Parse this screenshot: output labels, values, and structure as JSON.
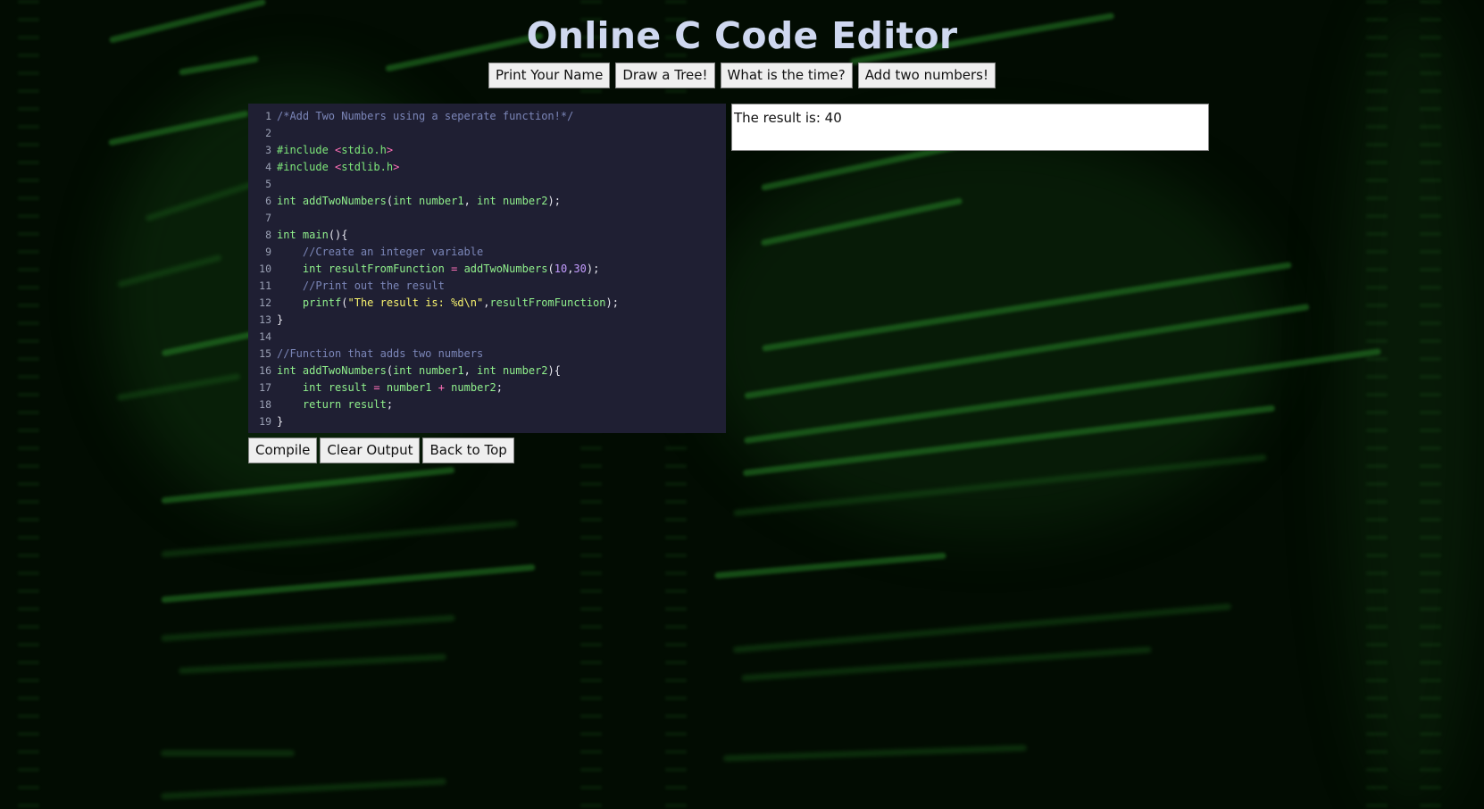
{
  "page": {
    "title": "Online C Code Editor"
  },
  "examples": [
    "Print Your Name",
    "Draw a Tree!",
    "What is the time?",
    "Add two numbers!"
  ],
  "editor": {
    "lines": [
      [
        [
          "comment",
          "/*Add Two Numbers using a seperate function!*/"
        ]
      ],
      [],
      [
        [
          "dir",
          "#include"
        ],
        [
          "punct",
          " "
        ],
        [
          "angle",
          "<"
        ],
        [
          "hdr",
          "stdio.h"
        ],
        [
          "angle",
          ">"
        ]
      ],
      [
        [
          "dir",
          "#include"
        ],
        [
          "punct",
          " "
        ],
        [
          "angle",
          "<"
        ],
        [
          "hdr",
          "stdlib.h"
        ],
        [
          "angle",
          ">"
        ]
      ],
      [],
      [
        [
          "type",
          "int"
        ],
        [
          "punct",
          " "
        ],
        [
          "fn",
          "addTwoNumbers"
        ],
        [
          "punct",
          "("
        ],
        [
          "type",
          "int"
        ],
        [
          "punct",
          " "
        ],
        [
          "var",
          "number1"
        ],
        [
          "punct",
          ", "
        ],
        [
          "type",
          "int"
        ],
        [
          "punct",
          " "
        ],
        [
          "var",
          "number2"
        ],
        [
          "punct",
          ");"
        ]
      ],
      [],
      [
        [
          "type",
          "int"
        ],
        [
          "punct",
          " "
        ],
        [
          "fn",
          "main"
        ],
        [
          "punct",
          "(){"
        ]
      ],
      [
        [
          "punct",
          "    "
        ],
        [
          "comment",
          "//Create an integer variable"
        ]
      ],
      [
        [
          "punct",
          "    "
        ],
        [
          "type",
          "int"
        ],
        [
          "punct",
          " "
        ],
        [
          "var",
          "resultFromFunction"
        ],
        [
          "punct",
          " "
        ],
        [
          "op",
          "="
        ],
        [
          "punct",
          " "
        ],
        [
          "fn",
          "addTwoNumbers"
        ],
        [
          "punct",
          "("
        ],
        [
          "num",
          "10"
        ],
        [
          "punct",
          ","
        ],
        [
          "num",
          "30"
        ],
        [
          "punct",
          ");"
        ]
      ],
      [
        [
          "punct",
          "    "
        ],
        [
          "comment",
          "//Print out the result"
        ]
      ],
      [
        [
          "punct",
          "    "
        ],
        [
          "fn",
          "printf"
        ],
        [
          "punct",
          "("
        ],
        [
          "str",
          "\"The result is: %d\\n\""
        ],
        [
          "punct",
          ","
        ],
        [
          "var",
          "resultFromFunction"
        ],
        [
          "punct",
          ");"
        ]
      ],
      [
        [
          "punct",
          "}"
        ]
      ],
      [],
      [
        [
          "comment",
          "//Function that adds two numbers"
        ]
      ],
      [
        [
          "type",
          "int"
        ],
        [
          "punct",
          " "
        ],
        [
          "fn",
          "addTwoNumbers"
        ],
        [
          "punct",
          "("
        ],
        [
          "type",
          "int"
        ],
        [
          "punct",
          " "
        ],
        [
          "var",
          "number1"
        ],
        [
          "punct",
          ", "
        ],
        [
          "type",
          "int"
        ],
        [
          "punct",
          " "
        ],
        [
          "var",
          "number2"
        ],
        [
          "punct",
          "){"
        ]
      ],
      [
        [
          "punct",
          "    "
        ],
        [
          "type",
          "int"
        ],
        [
          "punct",
          " "
        ],
        [
          "var",
          "result"
        ],
        [
          "punct",
          " "
        ],
        [
          "op",
          "="
        ],
        [
          "punct",
          " "
        ],
        [
          "var",
          "number1"
        ],
        [
          "punct",
          " "
        ],
        [
          "op",
          "+"
        ],
        [
          "punct",
          " "
        ],
        [
          "var",
          "number2"
        ],
        [
          "punct",
          ";"
        ]
      ],
      [
        [
          "punct",
          "    "
        ],
        [
          "type",
          "return"
        ],
        [
          "punct",
          " "
        ],
        [
          "var",
          "result"
        ],
        [
          "punct",
          ";"
        ]
      ],
      [
        [
          "punct",
          "}"
        ]
      ]
    ]
  },
  "actions": {
    "compile": "Compile",
    "clear": "Clear Output",
    "top": "Back to Top"
  },
  "output": {
    "text": "The result is: 40"
  }
}
